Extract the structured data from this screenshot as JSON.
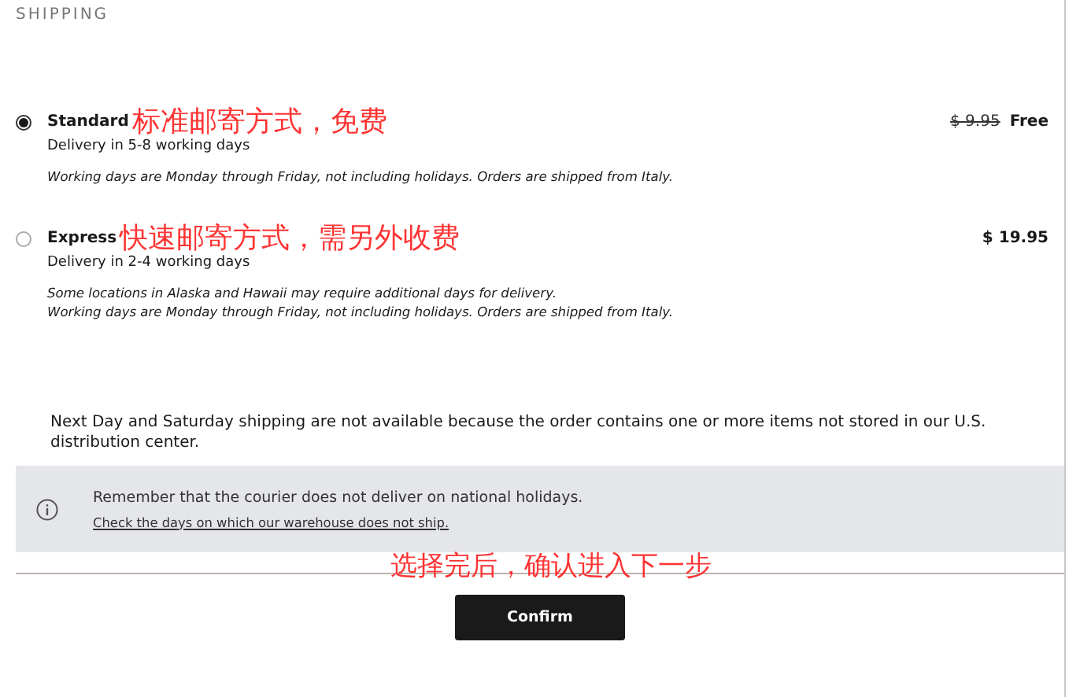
{
  "section_title": "SHIPPING",
  "options": [
    {
      "name": "Standard",
      "annotation": "标准邮寄方式，免费",
      "delivery": "Delivery in 5-8 working days",
      "notes": [
        "Working days are Monday through Friday, not including holidays. Orders are shipped from Italy."
      ],
      "old_price": "$ 9.95",
      "price": "Free",
      "selected": true
    },
    {
      "name": "Express",
      "annotation": "快速邮寄方式，需另外收费",
      "delivery": "Delivery in 2-4 working days",
      "notes": [
        "Some locations in Alaska and Hawaii may require additional days for delivery.",
        "Working days are Monday through Friday, not including holidays. Orders are shipped from Italy."
      ],
      "price": "$ 19.95",
      "selected": false
    }
  ],
  "availability_note": "Next Day and Saturday shipping are not available because the order contains one or more items not stored in our U.S. distribution center.",
  "info_box": {
    "message": "Remember that the courier does not deliver on national holidays.",
    "link": "Check the days on which our warehouse does not ship."
  },
  "footer_annotation": "选择完后，确认进入下一步",
  "confirm_button": "Confirm"
}
